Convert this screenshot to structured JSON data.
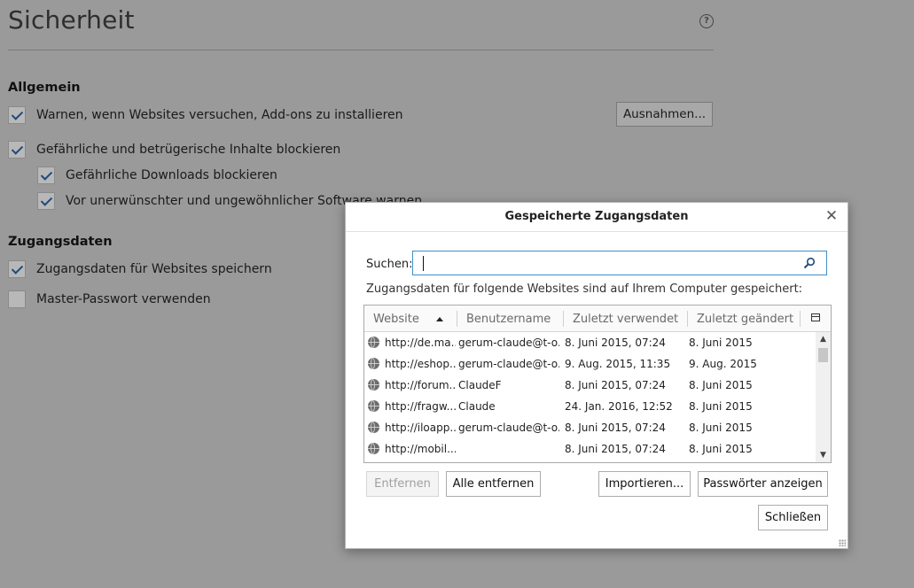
{
  "page": {
    "title": "Sicherheit",
    "help_icon_glyph": "?",
    "sections": {
      "general": {
        "heading": "Allgemein",
        "warn_addons": "Warnen, wenn Websites versuchen, Add-ons zu installieren",
        "exceptions_button": "Ausnahmen...",
        "block_dangerous": "Gefährliche und betrügerische Inhalte blockieren",
        "block_downloads": "Gefährliche Downloads blockieren",
        "warn_unwanted": "Vor unerwünschter und ungewöhnlicher Software warnen"
      },
      "logins": {
        "heading": "Zugangsdaten",
        "save_logins": "Zugangsdaten für Websites speichern",
        "master_password": "Master-Passwort verwenden"
      }
    }
  },
  "dialog": {
    "title": "Gespeicherte Zugangsdaten",
    "close_glyph": "✕",
    "search_label": "Suchen:",
    "search_value": "",
    "info": "Zugangsdaten für folgende Websites sind auf Ihrem Computer gespeichert:",
    "columns": [
      "Website",
      "Benutzername",
      "Zuletzt verwendet",
      "Zuletzt geändert"
    ],
    "rows": [
      {
        "site": "http://de.ma...",
        "user": "gerum-claude@t-o...",
        "used": "8. Juni 2015, 07:24",
        "changed": "8. Juni 2015"
      },
      {
        "site": "http://eshop....",
        "user": "gerum-claude@t-o...",
        "used": "9. Aug. 2015, 11:35",
        "changed": "9. Aug. 2015"
      },
      {
        "site": "http://forum...",
        "user": "ClaudeF",
        "used": "8. Juni 2015, 07:24",
        "changed": "8. Juni 2015"
      },
      {
        "site": "http://fragw...",
        "user": "Claude",
        "used": "24. Jan. 2016, 12:52",
        "changed": "8. Juni 2015"
      },
      {
        "site": "http://iloapp...",
        "user": "gerum-claude@t-o...",
        "used": "8. Juni 2015, 07:24",
        "changed": "8. Juni 2015"
      },
      {
        "site": "http://mobil...",
        "user": "",
        "used": "8. Juni 2015, 07:24",
        "changed": "8. Juni 2015"
      }
    ],
    "buttons": {
      "remove": "Entfernen",
      "remove_all": "Alle entfernen",
      "import": "Importieren...",
      "show_passwords": "Passwörter anzeigen",
      "close": "Schließen"
    }
  },
  "colors": {
    "accent": "#3f8fc9",
    "overlay": "#9a9a9a"
  }
}
